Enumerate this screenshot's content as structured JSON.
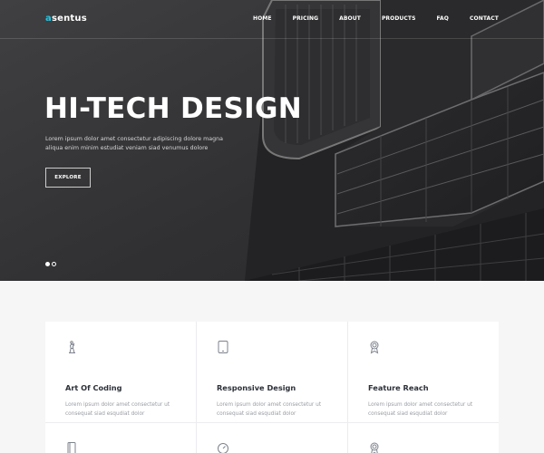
{
  "brand": {
    "logo_accent": "a",
    "logo_rest": "sentus",
    "accent_color": "#25c5e0"
  },
  "nav": {
    "items": [
      "HOME",
      "PRICING",
      "ABOUT",
      "PRODUCTS",
      "FAQ",
      "CONTACT"
    ]
  },
  "hero": {
    "title": "HI-TECH DESIGN",
    "text": "Lorem ipsum dolor amet consectetur adipiscing dolore magna aliqua enim minim estudiat veniam siad venumus dolore",
    "button_label": "EXPLORE",
    "slide_count": 2,
    "active_slide": 1
  },
  "features": [
    {
      "icon": "chess-piece-icon",
      "title": "Art Of Coding",
      "text": "Lorem ipsum dolor amet consectetur ut consequat siad esqudiat dolor"
    },
    {
      "icon": "tablet-icon",
      "title": "Responsive Design",
      "text": "Lorem ipsum dolor amet consectetur ut consequat siad esqudiat dolor"
    },
    {
      "icon": "award-badge-icon",
      "title": "Feature Reach",
      "text": "Lorem ipsum dolor amet consectetur ut consequat siad esqudiat dolor"
    },
    {
      "icon": "document-icon"
    },
    {
      "icon": "speedometer-icon"
    },
    {
      "icon": "award-badge-icon"
    }
  ]
}
